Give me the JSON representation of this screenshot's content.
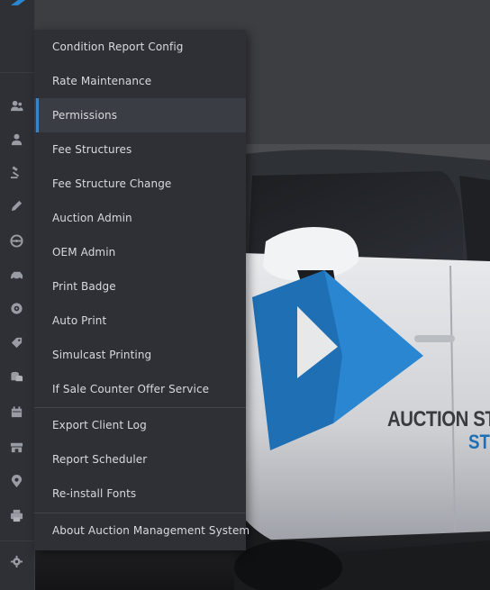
{
  "menu": {
    "items": [
      {
        "label": "Condition Report Config"
      },
      {
        "label": "Rate Maintenance"
      },
      {
        "label": "Permissions"
      },
      {
        "label": "Fee Structures"
      },
      {
        "label": "Fee Structure Change"
      },
      {
        "label": "Auction Admin"
      },
      {
        "label": "OEM Admin"
      },
      {
        "label": "Print Badge"
      },
      {
        "label": "Auto Print"
      },
      {
        "label": "Simulcast Printing"
      },
      {
        "label": "If Sale Counter Offer Service"
      },
      {
        "label": "Export Client Log"
      },
      {
        "label": "Report Scheduler"
      },
      {
        "label": "Re-install Fonts"
      },
      {
        "label": "About Auction Management System"
      }
    ],
    "active": "Permissions",
    "accent_color": "#3b83c4"
  },
  "sidebar": {
    "icons": [
      "users-icon",
      "user-icon",
      "gavel-icon",
      "pencil-icon",
      "steering-wheel-icon",
      "vehicle-icon",
      "disc-icon",
      "tag-icon",
      "coins-icon",
      "calendar-icon",
      "storefront-icon",
      "location-pin-icon",
      "printer-icon",
      "gear-icon"
    ]
  },
  "background": {
    "brand_line1": "AUCTION ST",
    "brand_line2": "ST",
    "brand_color_dark": "#3a3b3e",
    "brand_color_blue": "#1f6fb4"
  }
}
